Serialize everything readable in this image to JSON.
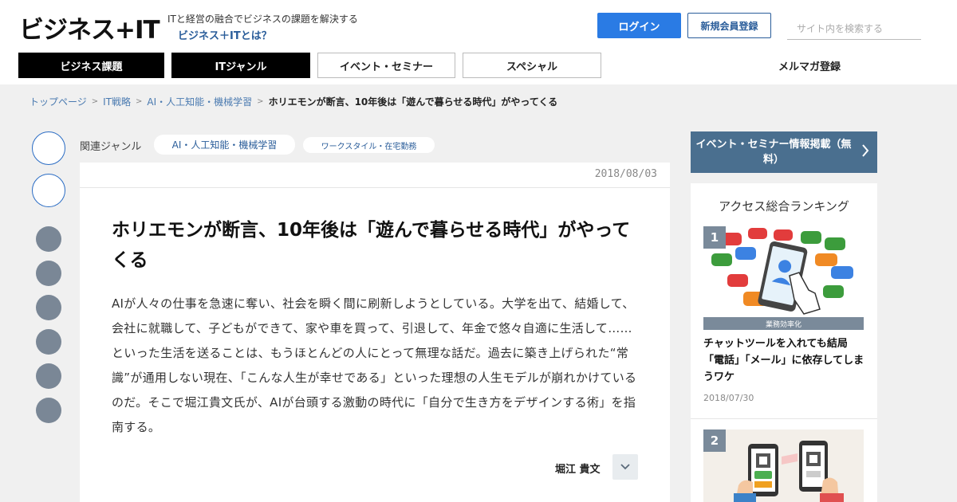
{
  "header": {
    "logo": "ビジネス+IT",
    "tagline": "ITと経営の融合でビジネスの課題を解決する",
    "about_link": "ビジネス＋ITとは？",
    "login_label": "ログイン",
    "register_label": "新規会員登録",
    "search_placeholder": "サイト内を検索する"
  },
  "nav": {
    "items": [
      {
        "label": "ビジネス課題"
      },
      {
        "label": "ITジャンル"
      },
      {
        "label": "イベント・セミナー"
      },
      {
        "label": "スペシャル"
      }
    ],
    "newsletter": "メルマガ登録"
  },
  "breadcrumb": {
    "items": [
      {
        "label": "トップページ"
      },
      {
        "label": "IT戦略"
      },
      {
        "label": "AI・人工知能・機械学習"
      }
    ],
    "current": "ホリエモンが断言、10年後は「遊んで暮らせる時代」がやってくる"
  },
  "genres": {
    "label": "関連ジャンル",
    "tags": [
      {
        "label": "AI・人工知能・機械学習"
      },
      {
        "label": "ワークスタイル・在宅勤務"
      }
    ]
  },
  "article": {
    "date": "2018/08/03",
    "title": "ホリエモンが断言、10年後は「遊んで暮らせる時代」がやってくる",
    "lead": "AIが人々の仕事を急速に奪い、社会を瞬く間に刷新しようとしている。大学を出て、結婚して、会社に就職して、子どもができて、家や車を買って、引退して、年金で悠々自適に生活して……といった生活を送ることは、もうほとんどの人にとって無理な話だ。過去に築き上げられた“常識”が通用しない現在、「こんな人生が幸せである」といった理想の人生モデルが崩れかけているのだ。そこで堀江貴文氏が、AIが台頭する激動の時代に「自分で生き方をデザインする術」を指南する。",
    "author": "堀江 貴文"
  },
  "sidebar": {
    "event_banner": "イベント・セミナー情報掲載（無料）",
    "ranking_title": "アクセス総合ランキング",
    "ranking": [
      {
        "rank": "1",
        "tag": "業務効率化",
        "headline": "チャットツールを入れても結局「電話」「メール」に依存してしまうワケ",
        "date": "2018/07/30"
      },
      {
        "rank": "2"
      }
    ]
  },
  "colors": {
    "accent_blue": "#2a7be4",
    "link_blue": "#2a5d9a",
    "share_gray": "#7a8796",
    "banner_slate": "#4a6f8f"
  }
}
